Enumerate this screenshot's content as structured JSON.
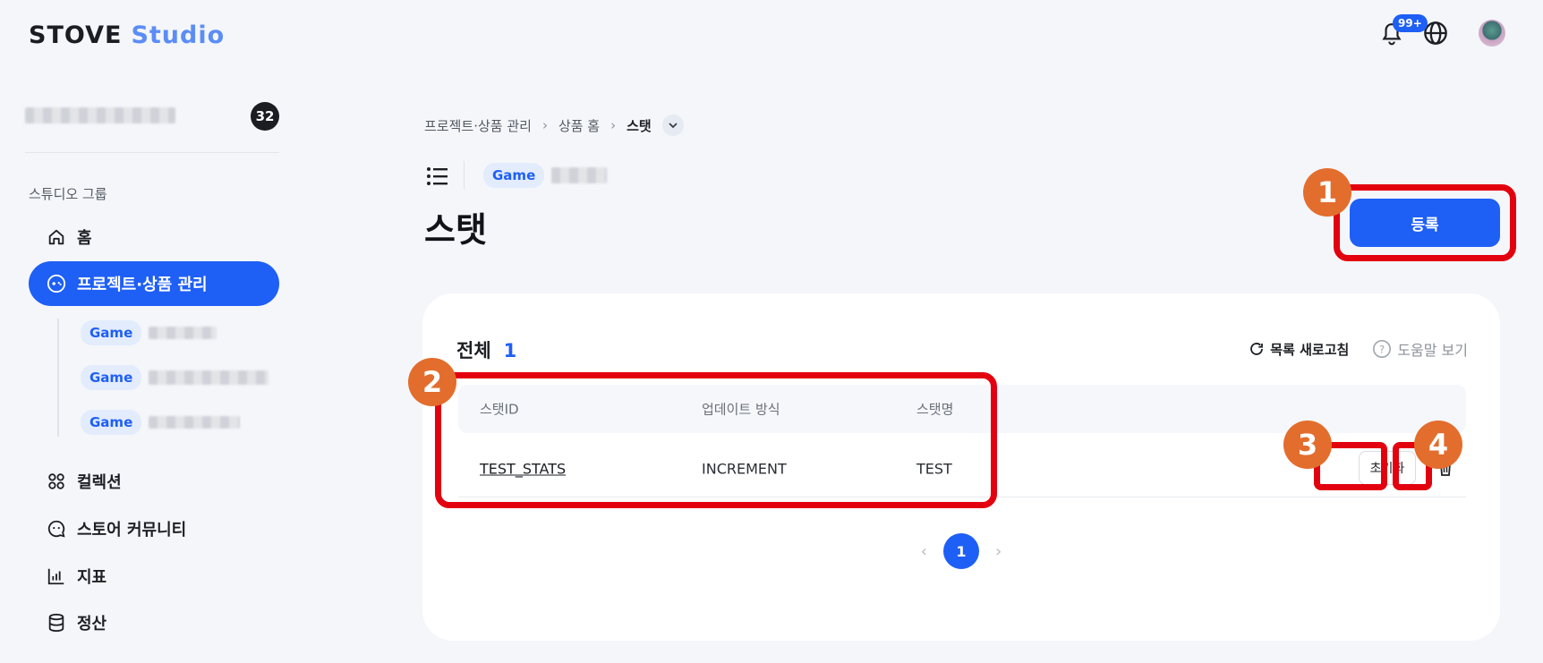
{
  "app": {
    "logo_primary": "STOVE",
    "logo_secondary": "Studio"
  },
  "header": {
    "notification_badge": "99+"
  },
  "sidebar": {
    "studio_count": "32",
    "group_label": "스튜디오 그룹",
    "items": [
      {
        "label": "홈",
        "icon": "home-icon"
      },
      {
        "label": "프로젝트·상품 관리",
        "icon": "gamepad-icon",
        "active": true
      },
      {
        "label": "컬렉션",
        "icon": "collection-icon"
      },
      {
        "label": "스토어 커뮤니티",
        "icon": "community-icon"
      },
      {
        "label": "지표",
        "icon": "chart-icon"
      },
      {
        "label": "정산",
        "icon": "database-icon"
      }
    ],
    "sub_items": [
      {
        "tag": "Game"
      },
      {
        "tag": "Game"
      },
      {
        "tag": "Game"
      }
    ]
  },
  "breadcrumb": {
    "items": [
      "프로젝트·상품 관리",
      "상품 홈",
      "스탯"
    ]
  },
  "page": {
    "tag": "Game",
    "title": "스탯",
    "register_label": "등록"
  },
  "card": {
    "total_label": "전체",
    "total_count": "1",
    "refresh_label": "목록 새로고침",
    "help_label": "도움말 보기",
    "columns": [
      "스탯ID",
      "업데이트 방식",
      "스탯명"
    ],
    "rows": [
      {
        "stat_id": "TEST_STATS",
        "update_type": "INCREMENT",
        "stat_name": "TEST",
        "reset_label": "초기화"
      }
    ],
    "current_page": "1"
  },
  "annotations": [
    "1",
    "2",
    "3",
    "4"
  ],
  "colors": {
    "accent": "#1e5ff5",
    "highlight": "#e3000f",
    "marker": "#e36d2d"
  }
}
